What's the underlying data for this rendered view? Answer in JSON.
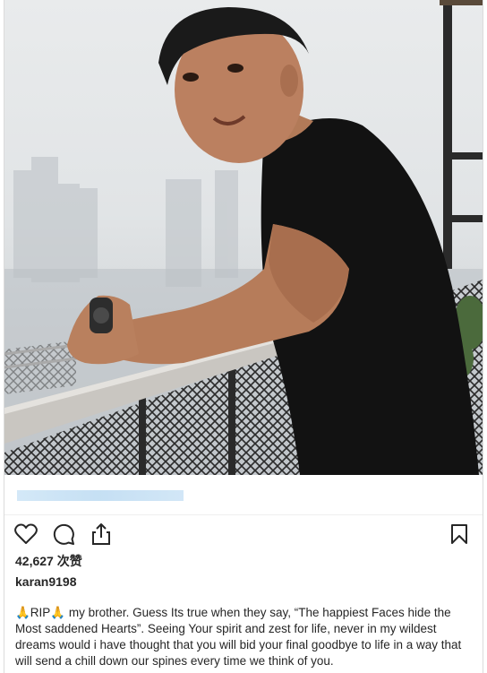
{
  "post": {
    "likes_count": "42,627",
    "likes_suffix": "次赞",
    "username": "karan9198",
    "caption_prefix": "🙏RIP🙏",
    "caption": " my brother. Guess Its true when they say, “The happiest Faces hide the Most saddened Hearts”. Seeing Your spirit and zest for life, never in my wildest dreams would i have thought that you will bid your final goodbye to life in a way that will send a chill down our spines every time we think of you."
  },
  "icons": {
    "like": "heart-icon",
    "comment": "comment-icon",
    "share": "share-icon",
    "save": "bookmark-icon"
  }
}
